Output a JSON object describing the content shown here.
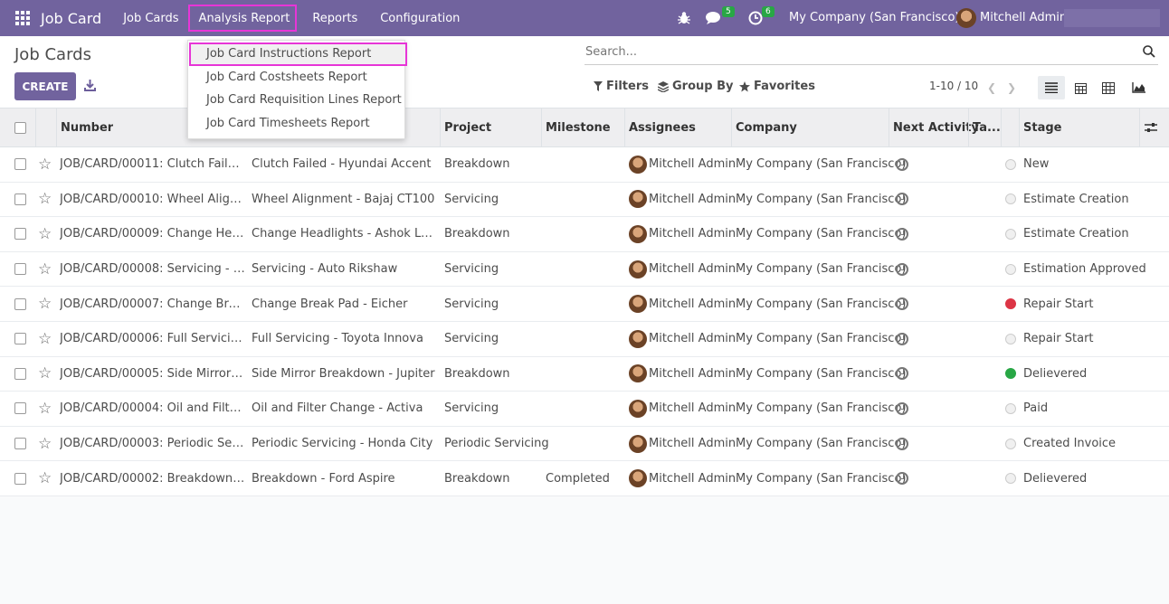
{
  "topbar": {
    "brand": "Job Card",
    "menus": [
      "Job Cards",
      "Analysis Report",
      "Reports",
      "Configuration"
    ],
    "chat_count": "5",
    "activity_count": "6",
    "company": "My Company (San Francisco)",
    "user": "Mitchell Admin"
  },
  "control": {
    "title": "Job Cards",
    "create_label": "CREATE",
    "search_placeholder": "Search...",
    "filters_label": "Filters",
    "groupby_label": "Group By",
    "favorites_label": "Favorites",
    "pager": "1-10 / 10"
  },
  "dropdown": {
    "items": [
      "Job Card Instructions Report",
      "Job Card Costsheets Report",
      "Job Card Requisition Lines Report",
      "Job Card Timesheets Report"
    ]
  },
  "table": {
    "headers": {
      "number": "Number",
      "project": "Project",
      "milestone": "Milestone",
      "assignees": "Assignees",
      "company": "Company",
      "next_activity": "Next Activity",
      "tags": "Ta...",
      "stage": "Stage"
    },
    "rows": [
      {
        "number": "JOB/CARD/00011: Clutch Failed ...",
        "name": "Clutch Failed - Hyundai Accent",
        "project": "Breakdown",
        "milestone": "",
        "assignee": "Mitchell Admin",
        "company": "My Company (San Francisco)",
        "stage": "New",
        "status": "normal"
      },
      {
        "number": "JOB/CARD/00010: Wheel Align...",
        "name": "Wheel Alignment - Bajaj CT100",
        "project": "Servicing",
        "milestone": "",
        "assignee": "Mitchell Admin",
        "company": "My Company (San Francisco)",
        "stage": "Estimate Creation",
        "status": "normal"
      },
      {
        "number": "JOB/CARD/00009: Change Head...",
        "name": "Change Headlights - Ashok Leyla...",
        "project": "Breakdown",
        "milestone": "",
        "assignee": "Mitchell Admin",
        "company": "My Company (San Francisco)",
        "stage": "Estimate Creation",
        "status": "normal"
      },
      {
        "number": "JOB/CARD/00008: Servicing - Au...",
        "name": "Servicing - Auto Rikshaw",
        "project": "Servicing",
        "milestone": "",
        "assignee": "Mitchell Admin",
        "company": "My Company (San Francisco)",
        "stage": "Estimation Approved",
        "status": "normal"
      },
      {
        "number": "JOB/CARD/00007: Change Brea...",
        "name": "Change Break Pad - Eicher",
        "project": "Servicing",
        "milestone": "",
        "assignee": "Mitchell Admin",
        "company": "My Company (San Francisco)",
        "stage": "Repair Start",
        "status": "blocked"
      },
      {
        "number": "JOB/CARD/00006: Full Servicing ...",
        "name": "Full Servicing - Toyota Innova",
        "project": "Servicing",
        "milestone": "",
        "assignee": "Mitchell Admin",
        "company": "My Company (San Francisco)",
        "stage": "Repair Start",
        "status": "normal"
      },
      {
        "number": "JOB/CARD/00005: Side Mirror B...",
        "name": "Side Mirror Breakdown - Jupiter",
        "project": "Breakdown",
        "milestone": "",
        "assignee": "Mitchell Admin",
        "company": "My Company (San Francisco)",
        "stage": "Delievered",
        "status": "done"
      },
      {
        "number": "JOB/CARD/00004: Oil and Filter ...",
        "name": "Oil and Filter Change - Activa",
        "project": "Servicing",
        "milestone": "",
        "assignee": "Mitchell Admin",
        "company": "My Company (San Francisco)",
        "stage": "Paid",
        "status": "normal"
      },
      {
        "number": "JOB/CARD/00003: Periodic Servi...",
        "name": "Periodic Servicing - Honda City",
        "project": "Periodic Servicing",
        "milestone": "",
        "assignee": "Mitchell Admin",
        "company": "My Company (San Francisco)",
        "stage": "Created Invoice",
        "status": "normal"
      },
      {
        "number": "JOB/CARD/00002: Breakdown - ...",
        "name": "Breakdown - Ford Aspire",
        "project": "Breakdown",
        "milestone": "Completed",
        "assignee": "Mitchell Admin",
        "company": "My Company (San Francisco)",
        "stage": "Delievered",
        "status": "normal"
      }
    ]
  }
}
